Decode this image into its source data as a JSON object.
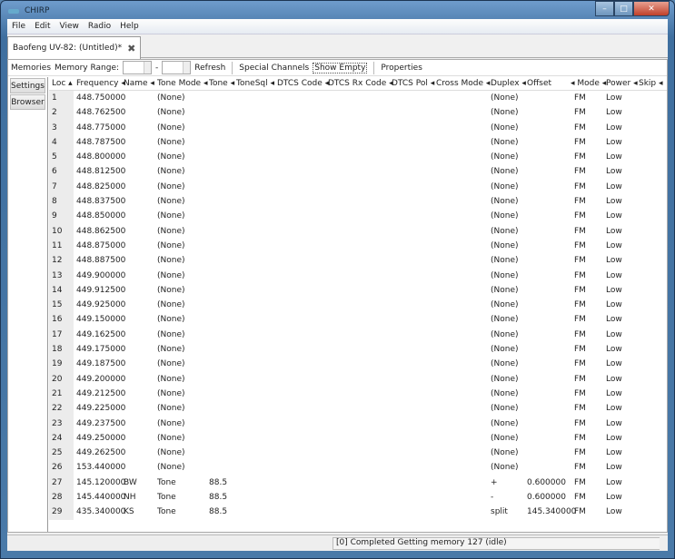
{
  "window": {
    "title": "CHIRP",
    "min": "–",
    "max": "□",
    "close": "✕"
  },
  "menu": [
    "File",
    "Edit",
    "View",
    "Radio",
    "Help"
  ],
  "tab": {
    "label": "Baofeng UV-82: (Untitled)*",
    "close": "✖"
  },
  "toolbar": {
    "memories": "Memories",
    "range_label": "Memory Range:",
    "range_from": "",
    "range_to": "",
    "dash": "-",
    "refresh": "Refresh",
    "special": "Special Channels",
    "show_empty": "Show Empty",
    "properties": "Properties"
  },
  "side": {
    "settings": "Settings",
    "browser": "Browser"
  },
  "columns": [
    "Loc ▴",
    "Frequency ◂",
    "Name ◂",
    "Tone Mode ◂",
    "Tone ◂",
    "ToneSql ◂",
    "DTCS Code ◂",
    "DTCS Rx Code ◂",
    "DTCS Pol ◂",
    "Cross Mode ◂",
    "Duplex ◂",
    "Offset",
    "◂ Mode ◂",
    "Power ◂",
    "Skip ◂"
  ],
  "rows": [
    [
      "1",
      "448.750000",
      "",
      "(None)",
      "",
      "(None)",
      "",
      "FM",
      "Low"
    ],
    [
      "2",
      "448.762500",
      "",
      "(None)",
      "",
      "(None)",
      "",
      "FM",
      "Low"
    ],
    [
      "3",
      "448.775000",
      "",
      "(None)",
      "",
      "(None)",
      "",
      "FM",
      "Low"
    ],
    [
      "4",
      "448.787500",
      "",
      "(None)",
      "",
      "(None)",
      "",
      "FM",
      "Low"
    ],
    [
      "5",
      "448.800000",
      "",
      "(None)",
      "",
      "(None)",
      "",
      "FM",
      "Low"
    ],
    [
      "6",
      "448.812500",
      "",
      "(None)",
      "",
      "(None)",
      "",
      "FM",
      "Low"
    ],
    [
      "7",
      "448.825000",
      "",
      "(None)",
      "",
      "(None)",
      "",
      "FM",
      "Low"
    ],
    [
      "8",
      "448.837500",
      "",
      "(None)",
      "",
      "(None)",
      "",
      "FM",
      "Low"
    ],
    [
      "9",
      "448.850000",
      "",
      "(None)",
      "",
      "(None)",
      "",
      "FM",
      "Low"
    ],
    [
      "10",
      "448.862500",
      "",
      "(None)",
      "",
      "(None)",
      "",
      "FM",
      "Low"
    ],
    [
      "11",
      "448.875000",
      "",
      "(None)",
      "",
      "(None)",
      "",
      "FM",
      "Low"
    ],
    [
      "12",
      "448.887500",
      "",
      "(None)",
      "",
      "(None)",
      "",
      "FM",
      "Low"
    ],
    [
      "13",
      "449.900000",
      "",
      "(None)",
      "",
      "(None)",
      "",
      "FM",
      "Low"
    ],
    [
      "14",
      "449.912500",
      "",
      "(None)",
      "",
      "(None)",
      "",
      "FM",
      "Low"
    ],
    [
      "15",
      "449.925000",
      "",
      "(None)",
      "",
      "(None)",
      "",
      "FM",
      "Low"
    ],
    [
      "16",
      "449.150000",
      "",
      "(None)",
      "",
      "(None)",
      "",
      "FM",
      "Low"
    ],
    [
      "17",
      "449.162500",
      "",
      "(None)",
      "",
      "(None)",
      "",
      "FM",
      "Low"
    ],
    [
      "18",
      "449.175000",
      "",
      "(None)",
      "",
      "(None)",
      "",
      "FM",
      "Low"
    ],
    [
      "19",
      "449.187500",
      "",
      "(None)",
      "",
      "(None)",
      "",
      "FM",
      "Low"
    ],
    [
      "20",
      "449.200000",
      "",
      "(None)",
      "",
      "(None)",
      "",
      "FM",
      "Low"
    ],
    [
      "21",
      "449.212500",
      "",
      "(None)",
      "",
      "(None)",
      "",
      "FM",
      "Low"
    ],
    [
      "22",
      "449.225000",
      "",
      "(None)",
      "",
      "(None)",
      "",
      "FM",
      "Low"
    ],
    [
      "23",
      "449.237500",
      "",
      "(None)",
      "",
      "(None)",
      "",
      "FM",
      "Low"
    ],
    [
      "24",
      "449.250000",
      "",
      "(None)",
      "",
      "(None)",
      "",
      "FM",
      "Low"
    ],
    [
      "25",
      "449.262500",
      "",
      "(None)",
      "",
      "(None)",
      "",
      "FM",
      "Low"
    ],
    [
      "26",
      "153.440000",
      "",
      "(None)",
      "",
      "(None)",
      "",
      "FM",
      "Low"
    ],
    [
      "27",
      "145.120000",
      "BW",
      "Tone",
      "88.5",
      "+",
      "0.600000",
      "FM",
      "Low"
    ],
    [
      "28",
      "145.440000",
      "NH",
      "Tone",
      "88.5",
      "-",
      "0.600000",
      "FM",
      "Low"
    ],
    [
      "29",
      "435.340000",
      "KS",
      "Tone",
      "88.5",
      "split",
      "145.340000",
      "FM",
      "Low"
    ]
  ],
  "status": "[0] Completed Getting memory 127 (idle)"
}
